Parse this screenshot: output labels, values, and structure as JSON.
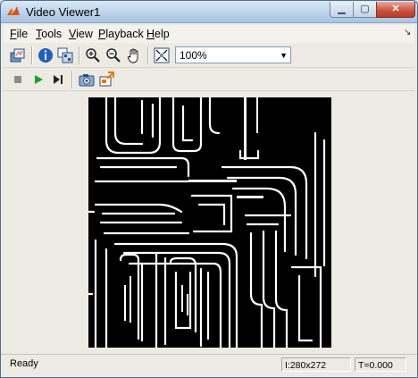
{
  "window": {
    "title": "Video Viewer1"
  },
  "menu": {
    "items": [
      {
        "first": "F",
        "rest": "ile"
      },
      {
        "first": "T",
        "rest": "ools"
      },
      {
        "first": "V",
        "rest": "iew"
      },
      {
        "first": "P",
        "rest": "layback"
      },
      {
        "first": "H",
        "rest": "elp"
      }
    ]
  },
  "toolbar": {
    "zoom_value": "100%",
    "icons": [
      "open-scope-icon",
      "info-icon",
      "pixel-region-icon",
      "zoom-in-icon",
      "zoom-out-icon",
      "pan-hand-icon",
      "fit-to-window-icon"
    ]
  },
  "playback_toolbar": {
    "icons": [
      "stop-icon",
      "play-icon",
      "step-forward-icon",
      "snapshot-icon",
      "highlight-icon"
    ]
  },
  "status": {
    "text": "Ready",
    "dimensions": "I:280x272",
    "time": "T=0.000"
  },
  "colors": {
    "title_gradient_top": "#dbe9f7",
    "close_button": "#c8513c",
    "image_background": "#000000",
    "play_green": "#1fa31f"
  }
}
